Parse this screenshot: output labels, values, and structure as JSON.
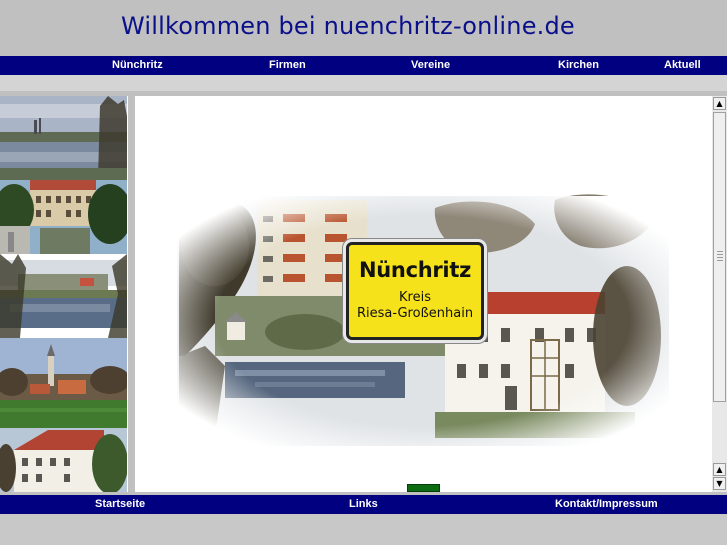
{
  "header": {
    "title": "Willkommen bei nuenchritz-online.de"
  },
  "top_nav": {
    "items": [
      {
        "label": "Nünchritz"
      },
      {
        "label": "Firmen"
      },
      {
        "label": "Vereine"
      },
      {
        "label": "Kirchen"
      },
      {
        "label": "Aktuell"
      }
    ]
  },
  "bottom_nav": {
    "items": [
      {
        "label": "Startseite"
      },
      {
        "label": "Links"
      },
      {
        "label": "Kontakt/Impressum"
      }
    ]
  },
  "hero": {
    "sign_town": "Nünchritz",
    "sign_line1": "Kreis",
    "sign_line2": "Riesa-Großenhain"
  },
  "colors": {
    "nav_background": "#000080",
    "nav_text": "#ffffff",
    "title_text": "#0a0f8a",
    "page_background": "#c0c0c0",
    "sign_yellow": "#f6e21a"
  },
  "icons": {
    "scroll_up": "triangle-up-icon",
    "scroll_down": "triangle-down-icon",
    "loading": "loading-indicator"
  }
}
